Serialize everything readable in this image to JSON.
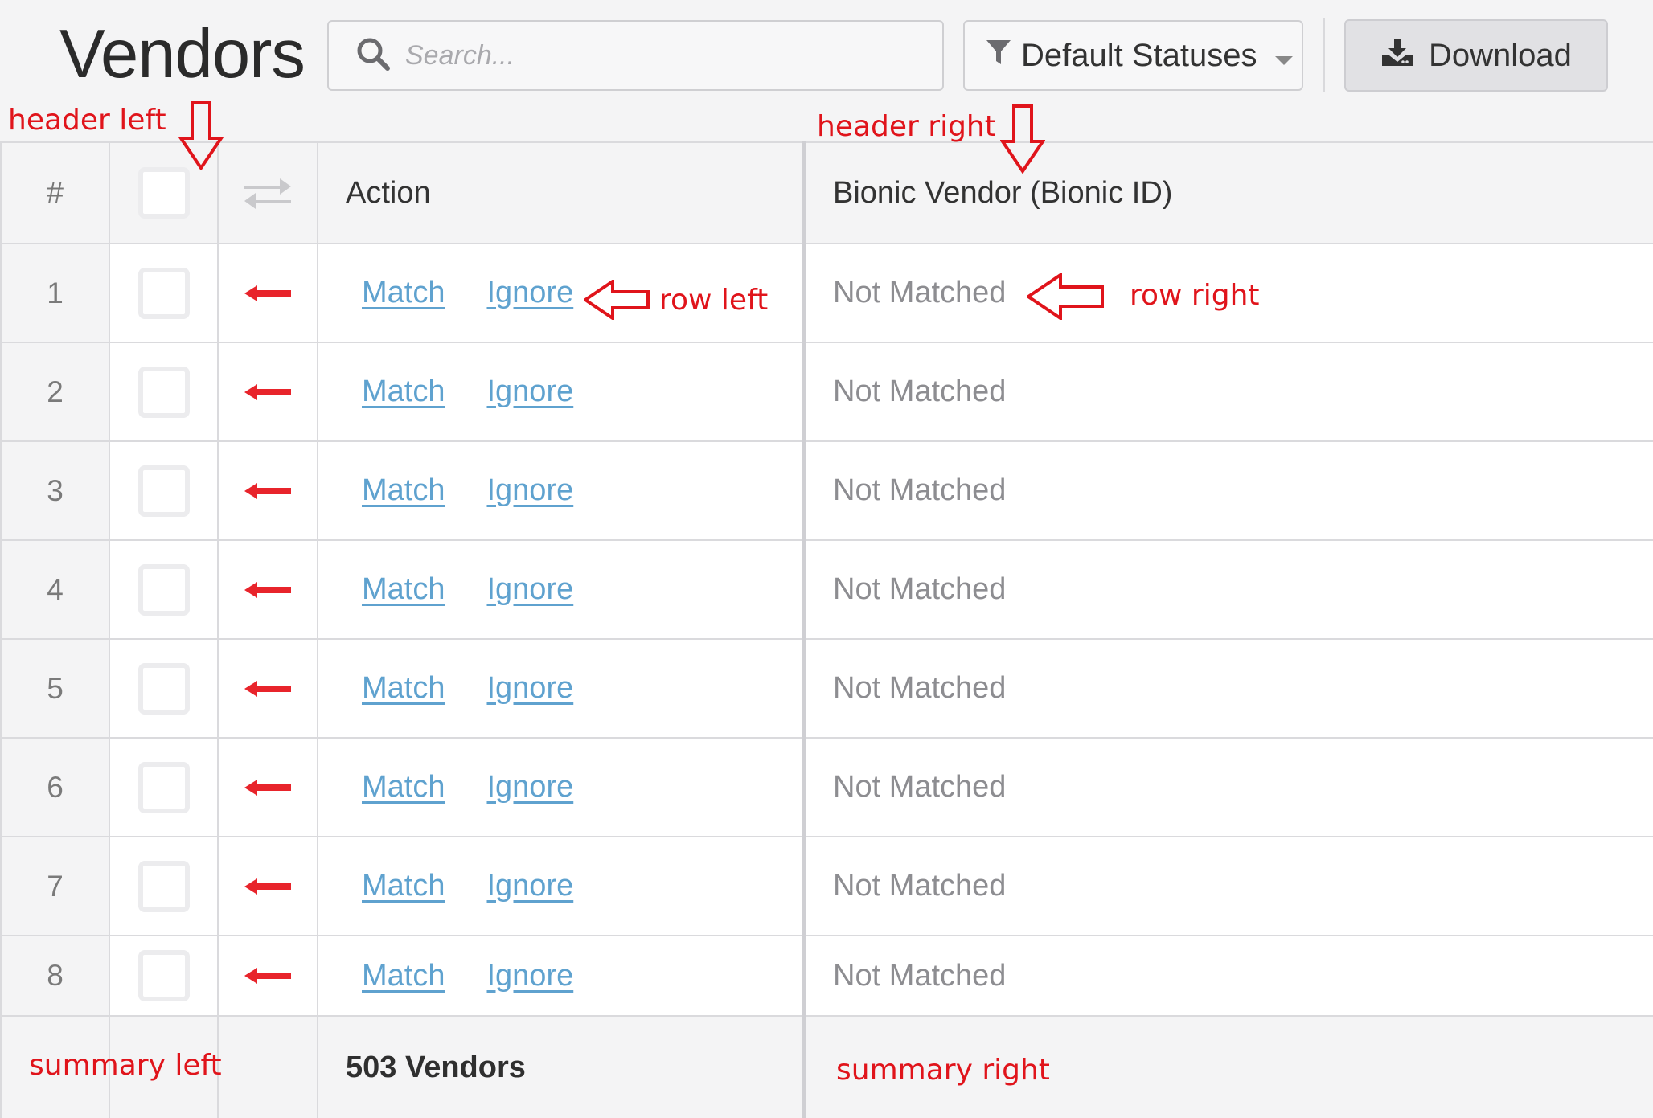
{
  "page": {
    "title": "Vendors"
  },
  "toolbar": {
    "search_placeholder": "Search...",
    "filter_label": "Default Statuses",
    "download_label": "Download"
  },
  "table": {
    "columns": {
      "number": "#",
      "action": "Action",
      "bionic_vendor": "Bionic Vendor (Bionic ID)"
    },
    "rows": [
      {
        "number": "1",
        "match": "Match",
        "ignore": "Ignore",
        "status": "Not Matched"
      },
      {
        "number": "2",
        "match": "Match",
        "ignore": "Ignore",
        "status": "Not Matched"
      },
      {
        "number": "3",
        "match": "Match",
        "ignore": "Ignore",
        "status": "Not Matched"
      },
      {
        "number": "4",
        "match": "Match",
        "ignore": "Ignore",
        "status": "Not Matched"
      },
      {
        "number": "5",
        "match": "Match",
        "ignore": "Ignore",
        "status": "Not Matched"
      },
      {
        "number": "6",
        "match": "Match",
        "ignore": "Ignore",
        "status": "Not Matched"
      },
      {
        "number": "7",
        "match": "Match",
        "ignore": "Ignore",
        "status": "Not Matched"
      },
      {
        "number": "8",
        "match": "Match",
        "ignore": "Ignore",
        "status": "Not Matched"
      }
    ],
    "summary": {
      "count_text": "503 Vendors"
    }
  },
  "annotations": {
    "header_left": "header left",
    "header_right": "header right",
    "row_left": "row left",
    "row_right": "row right",
    "summary_left": "summary left",
    "summary_right": "summary right"
  },
  "colors": {
    "link": "#5fa2cf",
    "annotation_red": "#e0141b",
    "row_arrow_red": "#e8242b",
    "header_bg": "#f4f4f5",
    "muted_text": "#8d8d91"
  },
  "icons": {
    "search": "search-icon",
    "filter": "filter-icon",
    "caret": "caret-down-icon",
    "download": "download-icon",
    "swap": "swap-arrows-icon",
    "row_arrow": "left-arrow-icon"
  }
}
